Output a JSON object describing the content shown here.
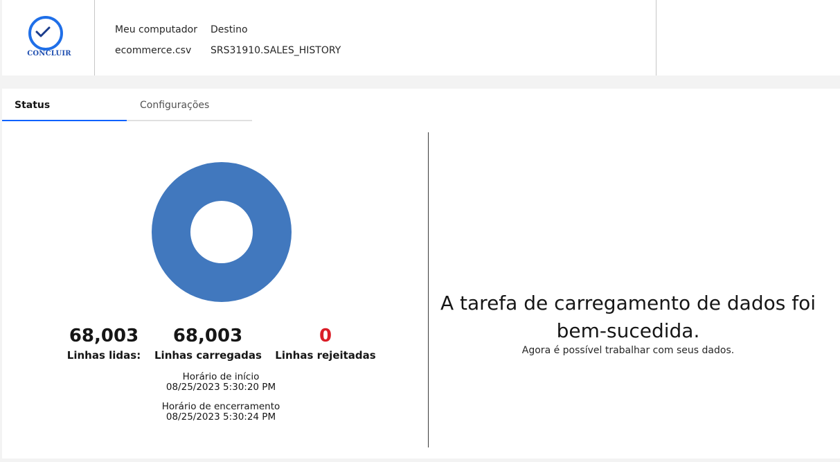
{
  "header": {
    "logo_text": "CONCLUIR",
    "source_label": "Meu computador",
    "dest_label": "Destino",
    "source_value": "ecommerce.csv",
    "dest_value": "SRS31910.SALES_HISTORY"
  },
  "tabs": [
    {
      "label": "Status",
      "active": true
    },
    {
      "label": "Configurações",
      "active": false
    }
  ],
  "chart_data": {
    "type": "pie",
    "categories": [
      "Linhas carregadas",
      "Linhas rejeitadas"
    ],
    "values": [
      68003,
      0
    ],
    "colors": [
      "#4178be",
      "#da1e28"
    ]
  },
  "stats": {
    "read": {
      "value": "68,003",
      "label": "Linhas lidas:"
    },
    "loaded": {
      "value": "68,003",
      "label": "Linhas carregadas"
    },
    "rejected": {
      "value": "0",
      "label": "Linhas rejeitadas"
    }
  },
  "times": {
    "start_label": "Horário de início",
    "start_value": "08/25/2023 5:30:20 PM",
    "end_label": "Horário de encerramento",
    "end_value": "08/25/2023 5:30:24 PM"
  },
  "message": {
    "title": "A tarefa de carregamento de dados foi bem-sucedida.",
    "subtitle": "Agora é possível trabalhar com seus dados."
  },
  "colors": {
    "accent": "#0f62fe",
    "donut": "#4178be",
    "rejected": "#da1e28"
  }
}
